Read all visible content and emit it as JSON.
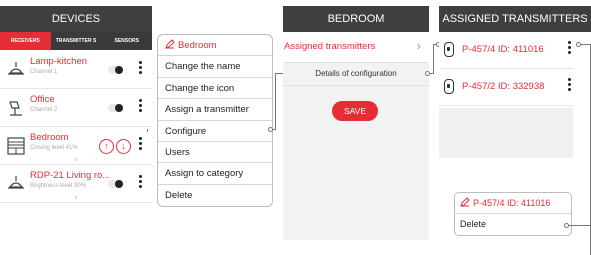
{
  "devices": {
    "title": "DEVICES",
    "tabs": [
      {
        "label": "RECEIVERS"
      },
      {
        "label": "TRANSMITTER S"
      },
      {
        "label": "SENSORS"
      }
    ],
    "items": [
      {
        "name": "Lamp-kitchen",
        "sub": "Channel 1",
        "icon": "lamp-icon"
      },
      {
        "name": "Office",
        "sub": "Channel 2",
        "icon": "desk-lamp-icon"
      },
      {
        "name": "Bedroom",
        "sub": "Closing level 41%",
        "icon": "blinds-icon"
      },
      {
        "name": "RDP-21 Living ro...",
        "sub": "Brightness level 30%",
        "icon": "lamp-icon"
      }
    ]
  },
  "context_menu": {
    "header": "Bedroom",
    "items": [
      "Change the name",
      "Change the icon",
      "Assign a transmitter",
      "Configure",
      "Users",
      "Assign to category",
      "Delete"
    ]
  },
  "bedroom": {
    "title": "BEDROOM",
    "assigned_label": "Assigned transmitters",
    "config_label": "Details of configuration",
    "save_label": "SAVE"
  },
  "assigned": {
    "title": "ASSIGNED TRANSMITTERS",
    "items": [
      {
        "name": "P-457/4 ID: 411016"
      },
      {
        "name": "P-457/2 ID: 332938"
      }
    ]
  },
  "transmitter_menu": {
    "header": "P-457/4 ID: 411016",
    "delete_label": "Delete"
  },
  "colors": {
    "accent": "#e52d35",
    "header_bg": "#3f3f3f"
  }
}
